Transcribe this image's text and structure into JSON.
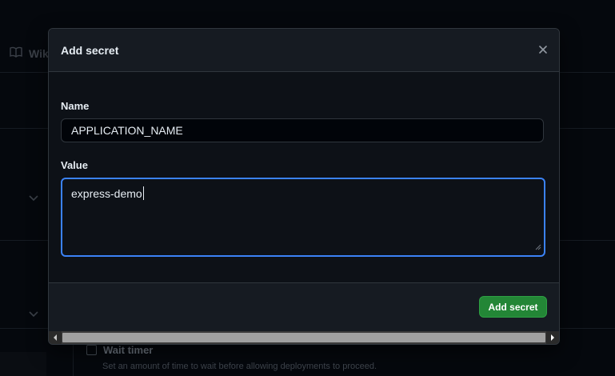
{
  "background": {
    "nav_item_label": "Wiki",
    "wait_timer_label": "Wait timer",
    "wait_timer_description": "Set an amount of time to wait before allowing deployments to proceed."
  },
  "modal": {
    "title": "Add secret",
    "name_label": "Name",
    "name_value": "APPLICATION_NAME",
    "value_label": "Value",
    "value_text": "express-demo",
    "submit_label": "Add secret"
  },
  "colors": {
    "primary_button": "#238636",
    "focus_border": "#3b82f6",
    "modal_background": "#0d1117"
  },
  "icons": {
    "close": "close-icon",
    "book": "book-icon",
    "chevron": "chevron-down-icon",
    "scroll_left": "scroll-left-icon",
    "scroll_right": "scroll-right-icon",
    "resize": "resize-grip-icon"
  }
}
